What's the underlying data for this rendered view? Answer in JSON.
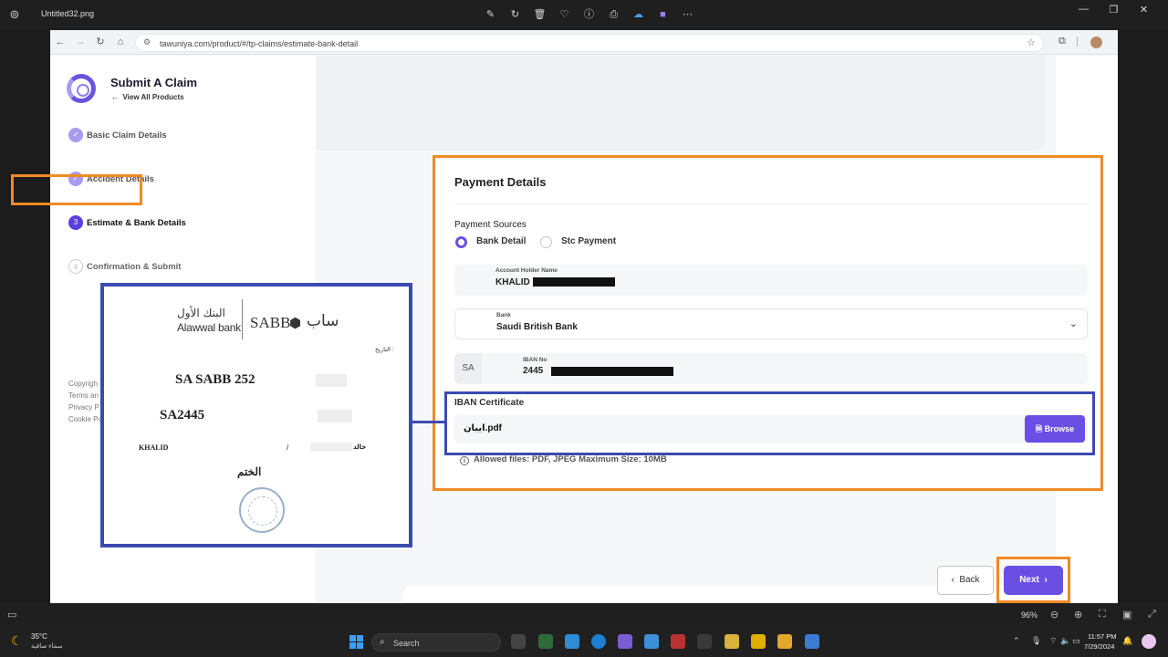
{
  "viewer": {
    "file_name": "Untitled32.png",
    "tools": [
      "edit-icon",
      "rotate-icon",
      "delete-icon",
      "favorite-icon",
      "info-icon",
      "print-icon",
      "onedrive-icon",
      "clipchamp-icon",
      "more-icon"
    ],
    "zoom": "96%"
  },
  "browser": {
    "url": "tawuniya.com/product/#/tp-claims/estimate-bank-detail"
  },
  "sidebar": {
    "title": "Submit A Claim",
    "back_link": "View All Products",
    "steps": [
      {
        "label": "Basic Claim Details",
        "state": "done",
        "marker": "✓"
      },
      {
        "label": "Accident Details",
        "state": "done",
        "marker": "✓"
      },
      {
        "label": "Estimate & Bank Details",
        "state": "active",
        "marker": "3"
      },
      {
        "label": "Confirmation & Submit",
        "state": "pending",
        "marker": "4"
      }
    ],
    "footer": [
      "Copyrigh",
      "Terms an",
      "Privacy P",
      "Cookie Po"
    ]
  },
  "payment": {
    "title": "Payment Details",
    "sources_label": "Payment Sources",
    "options": [
      {
        "label": "Bank Detail",
        "selected": true
      },
      {
        "label": "Stc Payment",
        "selected": false
      }
    ],
    "account_holder": {
      "label": "Account Holder Name",
      "value": "KHALID"
    },
    "bank": {
      "label": "Bank",
      "value": "Saudi British Bank"
    },
    "iban": {
      "prefix": "SA",
      "label": "IBAN No",
      "value": "2445"
    },
    "certificate": {
      "label": "IBAN Certificate",
      "file": "ايبان.pdf",
      "browse_label": "Browse",
      "allowed_note": "Allowed files: PDF, JPEG Maximum Size: 10MB"
    }
  },
  "actions": {
    "back_label": "Back",
    "next_label": "Next"
  },
  "document": {
    "bank_ar": "البنك الأول",
    "bank_en": "Alawwal bank",
    "sabb_en": "SABB",
    "sabb_ar": "ساب",
    "date_label": "التاريخ :",
    "line1": "SA SABB 252",
    "line2": "SA2445",
    "name": "KHALID",
    "slash": "/",
    "name_ar": "خالد",
    "seal_label": "الختم"
  },
  "taskbar": {
    "temperature": "35°C",
    "weather_desc": "سماء صافية",
    "search_placeholder": "Search",
    "time": "11:57 PM",
    "date": "7/29/2024"
  },
  "colors": {
    "accent": "#6a4fe5",
    "highlight_orange": "#f08a24",
    "highlight_blue": "#3b4bb0"
  }
}
